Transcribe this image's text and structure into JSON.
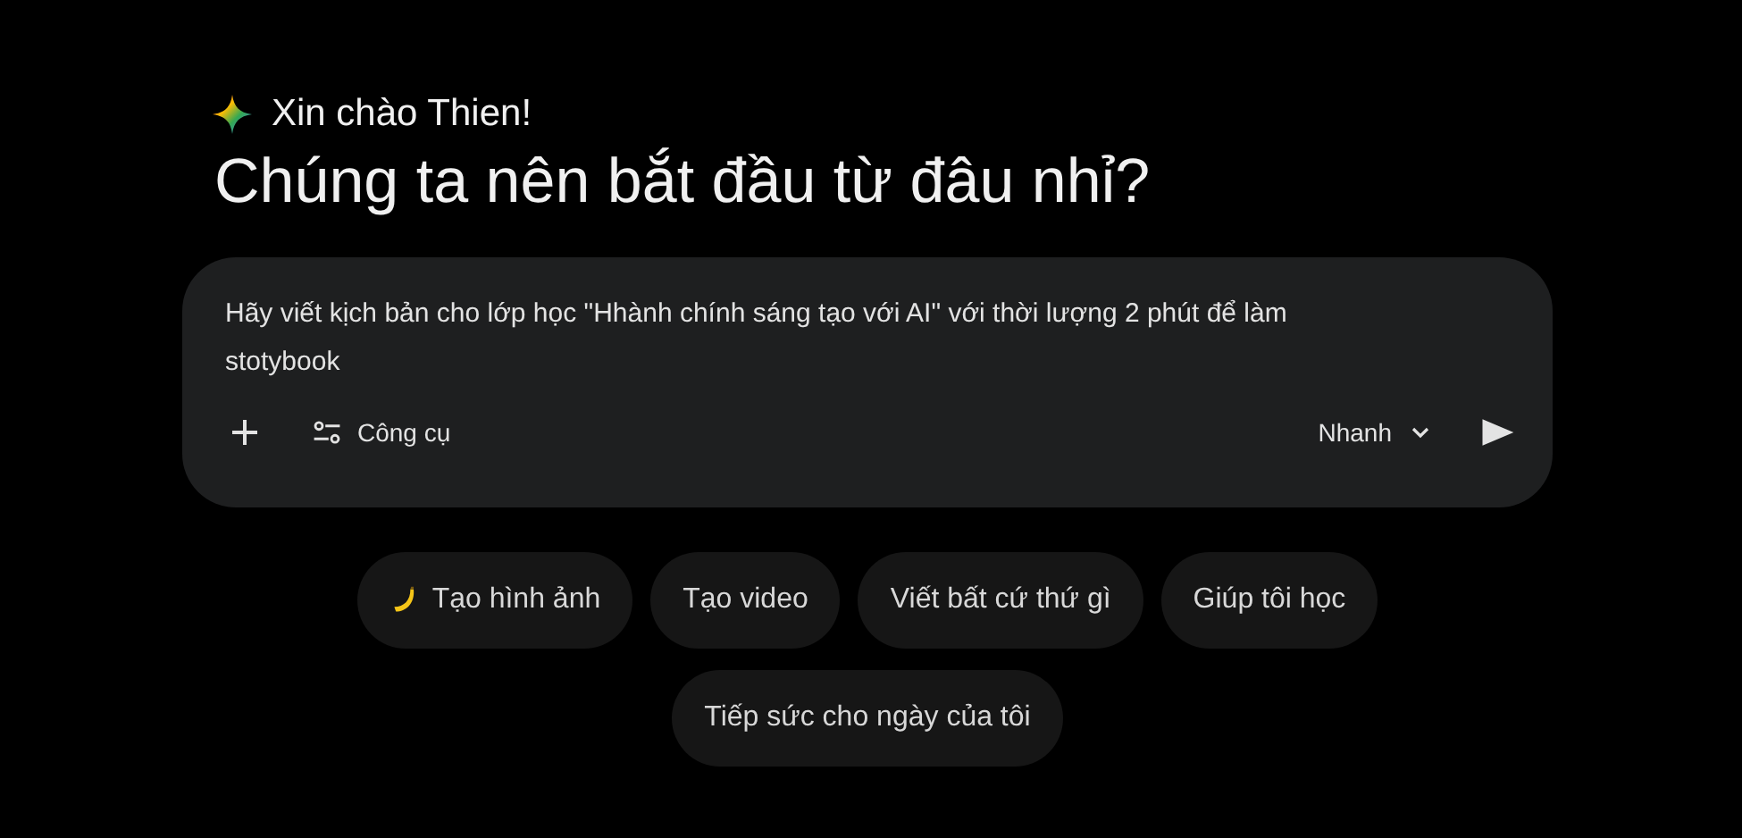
{
  "greeting": "Xin chào Thien!",
  "heading": "Chúng ta nên bắt đầu từ đâu nhỉ?",
  "prompt": {
    "value": "Hãy viết kịch bản cho lớp học \"Hhành chính sáng tạo với AI\" với thời lượng 2 phút để làm stotybook",
    "tools_label": "Công cụ",
    "mode": "Nhanh"
  },
  "chips": [
    {
      "label": "Tạo hình ảnh",
      "kind": "with-icon"
    },
    {
      "label": "Tạo video",
      "kind": "plain"
    },
    {
      "label": "Viết bất cứ thứ gì",
      "kind": "plain"
    },
    {
      "label": "Giúp tôi học",
      "kind": "plain"
    },
    {
      "label": "Tiếp sức cho ngày của tôi",
      "kind": "plain"
    }
  ]
}
